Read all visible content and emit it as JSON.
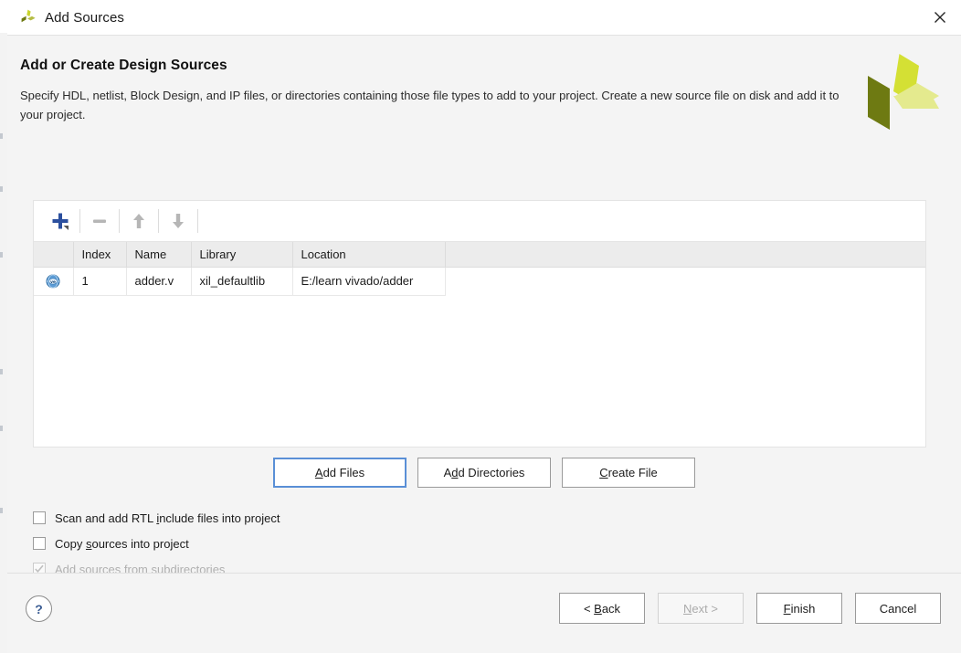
{
  "window": {
    "title": "Add Sources",
    "app_icon": "xilinx-logo-icon",
    "close_icon": "close-icon"
  },
  "header": {
    "title": "Add or Create Design Sources",
    "description": "Specify HDL, netlist, Block Design, and IP files, or directories containing those file types to add to your project. Create a new source file on disk and add it to your project.",
    "brand_logo": "xilinx-logo"
  },
  "toolbar": {
    "buttons": [
      {
        "name": "add-source-button",
        "icon": "plus-icon",
        "enabled": true,
        "color": "#2b4f9e"
      },
      {
        "name": "remove-source-button",
        "icon": "minus-icon",
        "enabled": false,
        "color": "#b6b6b6"
      },
      {
        "name": "move-up-button",
        "icon": "arrow-up-icon",
        "enabled": false,
        "color": "#b6b6b6"
      },
      {
        "name": "move-down-button",
        "icon": "arrow-down-icon",
        "enabled": false,
        "color": "#b6b6b6"
      }
    ]
  },
  "sources_table": {
    "columns": [
      "",
      "Index",
      "Name",
      "Library",
      "Location"
    ],
    "rows": [
      {
        "icon": "verilog-file-icon",
        "index": "1",
        "name": "adder.v",
        "library": "xil_defaultlib",
        "location": "E:/learn vivado/adder"
      }
    ]
  },
  "action_buttons": [
    {
      "label": "Add Files",
      "mnemonic_before": "",
      "mnemonic": "A",
      "mnemonic_after": "dd Files",
      "focused": true,
      "enabled": true
    },
    {
      "label": "Add Directories",
      "mnemonic_before": "A",
      "mnemonic": "d",
      "mnemonic_after": "d Directories",
      "focused": false,
      "enabled": true
    },
    {
      "label": "Create File",
      "mnemonic_before": "",
      "mnemonic": "C",
      "mnemonic_after": "reate File",
      "focused": false,
      "enabled": true
    }
  ],
  "options": [
    {
      "before": "Scan and add RTL ",
      "mnemonic": "i",
      "after": "nclude files into project",
      "checked": false,
      "enabled": true
    },
    {
      "before": "Copy ",
      "mnemonic": "s",
      "after": "ources into project",
      "checked": false,
      "enabled": true
    },
    {
      "before": "Add so",
      "mnemonic": "u",
      "after": "rces from subdirectories",
      "checked": true,
      "enabled": false
    }
  ],
  "footer": {
    "help_label": "?",
    "buttons": [
      {
        "before": "< ",
        "mnemonic": "B",
        "after": "ack",
        "enabled": true
      },
      {
        "before": "",
        "mnemonic": "N",
        "after": "ext >",
        "enabled": false
      },
      {
        "before": "",
        "mnemonic": "F",
        "after": "inish",
        "enabled": true
      },
      {
        "before": "Cancel",
        "mnemonic": "",
        "after": "",
        "enabled": true
      }
    ]
  },
  "colors": {
    "accent_blue": "#2b4f9e",
    "focus_blue": "#5a8fd6",
    "logo_dark": "#6e7a12",
    "logo_mid": "#d4e034",
    "logo_light": "#e4ea8e",
    "dialog_bg": "#f4f4f4",
    "panel_bg": "#ffffff",
    "header_row_bg": "#ececec"
  }
}
